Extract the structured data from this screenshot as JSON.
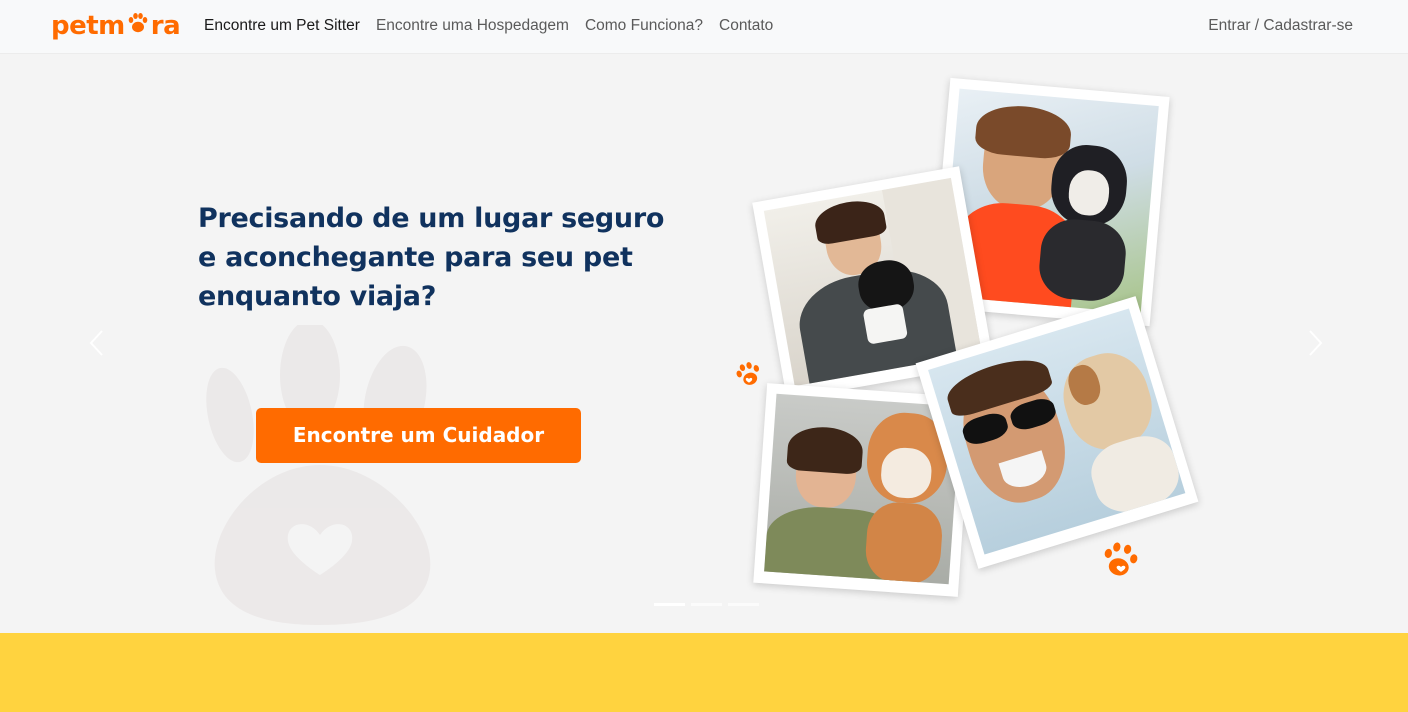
{
  "brand": {
    "logo_text_left": "petm",
    "logo_text_right": "ra",
    "color": "#ff6b00"
  },
  "nav": {
    "items": [
      {
        "label": "Encontre um Pet Sitter",
        "active": true
      },
      {
        "label": "Encontre uma Hospedagem",
        "active": false
      },
      {
        "label": "Como Funciona?",
        "active": false
      },
      {
        "label": "Contato",
        "active": false
      }
    ],
    "login_label": "Entrar / Cadastrar-se"
  },
  "hero": {
    "headline_line1": "Precisando de um lugar seguro",
    "headline_line2": "e aconchegante para seu pet",
    "headline_line3": "enquanto viaja?",
    "cta_label": "Encontre um Cuidador",
    "headline_color": "#10325e",
    "accent_color": "#ff6b00"
  },
  "carousel": {
    "prev_icon": "chevron-left-icon",
    "next_icon": "chevron-right-icon",
    "slide_count": 3,
    "active_slide": 1
  },
  "photos": [
    {
      "name": "photo-woman-with-cat"
    },
    {
      "name": "photo-woman-with-bulldog"
    },
    {
      "name": "photo-woman-with-shiba"
    },
    {
      "name": "photo-man-with-terrier"
    }
  ],
  "footer_band": {
    "color": "#ffd33f"
  }
}
